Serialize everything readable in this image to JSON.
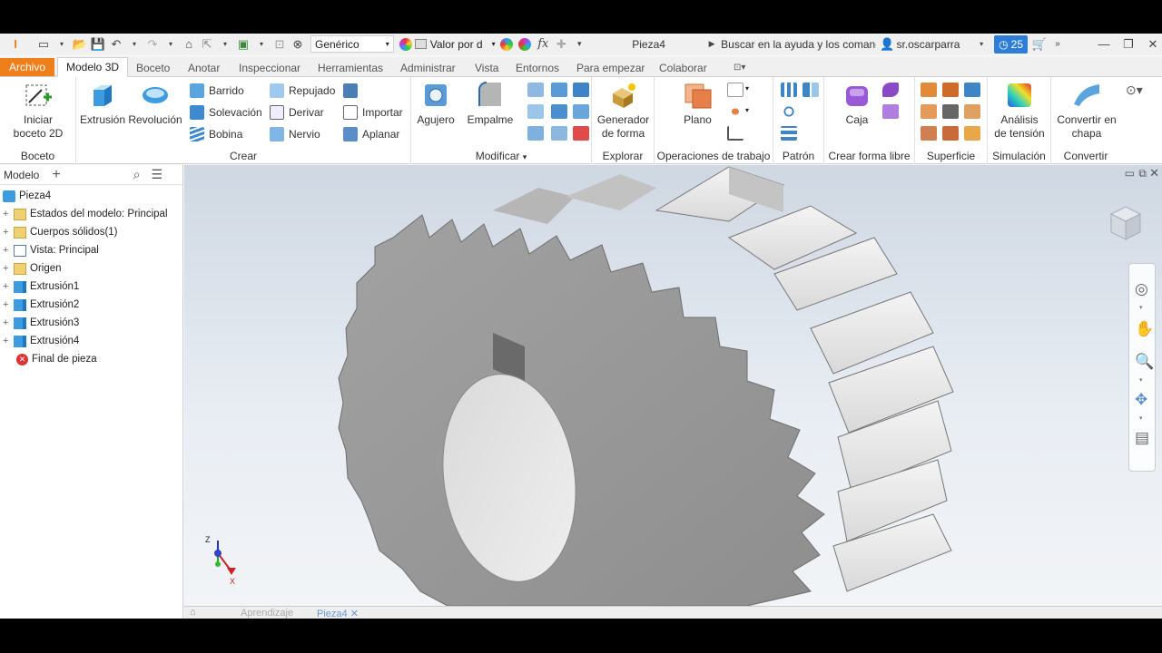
{
  "qat": {
    "material": "Genérico",
    "appearance": "Valor por d",
    "doc_title": "Pieza4",
    "search_placeholder": "Buscar en la ayuda y los comanc",
    "user": "sr.oscarparra",
    "notifications": "25"
  },
  "menu": {
    "tabs": [
      "Archivo",
      "Modelo 3D",
      "Boceto",
      "Anotar",
      "Inspeccionar",
      "Herramientas",
      "Administrar",
      "Vista",
      "Entornos",
      "Para empezar",
      "Colaborar"
    ]
  },
  "ribbon": {
    "boceto": {
      "title": "Boceto",
      "start_sketch": "Iniciar\nboceto 2D"
    },
    "crear": {
      "title": "Crear",
      "extrusion": "Extrusión",
      "revolucion": "Revolución",
      "barrido": "Barrido",
      "solevacion": "Solevación",
      "bobina": "Bobina",
      "repujado": "Repujado",
      "derivar": "Derivar",
      "nervio": "Nervio",
      "importar": "Importar",
      "aplanar": "Aplanar"
    },
    "modificar": {
      "title": "Modificar",
      "agujero": "Agujero",
      "empalme": "Empalme"
    },
    "explorar": {
      "title": "Explorar",
      "generador": "Generador\nde forma"
    },
    "operaciones": {
      "title": "Operaciones de trabajo",
      "plano": "Plano"
    },
    "patron": {
      "title": "Patrón"
    },
    "forma_libre": {
      "title": "Crear forma libre",
      "caja": "Caja"
    },
    "superficie": {
      "title": "Superficie"
    },
    "simulacion": {
      "title": "Simulación",
      "analisis": "Análisis\nde tensión"
    },
    "convertir": {
      "title": "Convertir",
      "chapa": "Convertir en\nchapa"
    }
  },
  "browser": {
    "tab_label": "Modelo",
    "root": "Pieza4",
    "nodes": [
      {
        "label": "Estados del modelo: Principal",
        "icon": "folder-icon"
      },
      {
        "label": "Cuerpos sólidos(1)",
        "icon": "folder-icon"
      },
      {
        "label": "Vista: Principal",
        "icon": "view-icon"
      },
      {
        "label": "Origen",
        "icon": "folder-icon"
      },
      {
        "label": "Extrusión1",
        "icon": "extrusion-icon"
      },
      {
        "label": "Extrusión2",
        "icon": "extrusion-icon"
      },
      {
        "label": "Extrusión3",
        "icon": "extrusion-icon"
      },
      {
        "label": "Extrusión4",
        "icon": "extrusion-icon"
      },
      {
        "label": "Final de pieza",
        "icon": "end-of-part-icon"
      }
    ]
  },
  "doc_tabs": {
    "home": "Aprendizaje",
    "active": "Pieza4"
  },
  "triad": {
    "z": "Z",
    "x": "X"
  },
  "colors": {
    "accent": "#ef7f1a",
    "active_tab_bg": "#ffffff",
    "viewport_top": "#cfd7e2",
    "part_gray": "#9a9a9a"
  }
}
